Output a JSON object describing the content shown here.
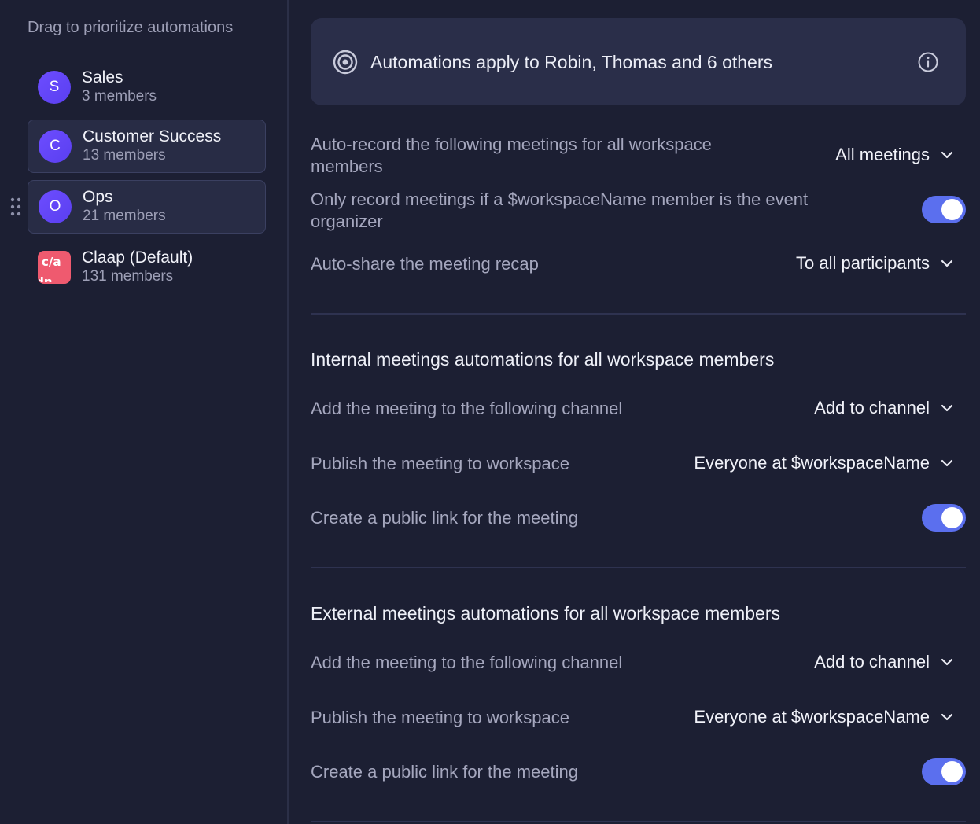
{
  "sidebar": {
    "hint": "Drag to prioritize automations",
    "groups": [
      {
        "initial": "S",
        "name": "Sales",
        "count": "3 members",
        "selected": false
      },
      {
        "initial": "C",
        "name": "Customer Success",
        "count": "13 members",
        "selected": true
      },
      {
        "initial": "O",
        "name": "Ops",
        "count": "21 members",
        "selected": true
      },
      {
        "initial": "Claap",
        "name": "Claap (Default)",
        "count": "131 members",
        "selected": false
      }
    ]
  },
  "banner": {
    "text": "Automations apply to Robin, Thomas and 6 others"
  },
  "general": {
    "auto_record_label": "Auto-record the following meetings for all workspace members",
    "auto_record_value": "All meetings",
    "organizer_only_label": "Only record meetings if a $workspaceName member is the event organizer",
    "organizer_only_enabled": true,
    "auto_share_label": "Auto-share the meeting recap",
    "auto_share_value": "To all participants"
  },
  "internal": {
    "title": "Internal meetings automations for all workspace members",
    "channel_label": "Add the meeting to the following channel",
    "channel_value": "Add to channel",
    "publish_label": "Publish the meeting to workspace",
    "publish_value": "Everyone at $workspaceName",
    "public_link_label": "Create a public link for the meeting",
    "public_link_enabled": true
  },
  "external": {
    "title": "External meetings automations for all workspace members",
    "channel_label": "Add the meeting to the following channel",
    "channel_value": "Add to channel",
    "publish_label": "Publish the meeting to workspace",
    "publish_value": "Everyone at $workspaceName",
    "public_link_label": "Create a public link for the meeting",
    "public_link_enabled": true
  },
  "colors": {
    "background": "#1c1f33",
    "accent": "#5b6fee",
    "avatar": "#6d4dff",
    "logo": "#ef5a6f"
  }
}
